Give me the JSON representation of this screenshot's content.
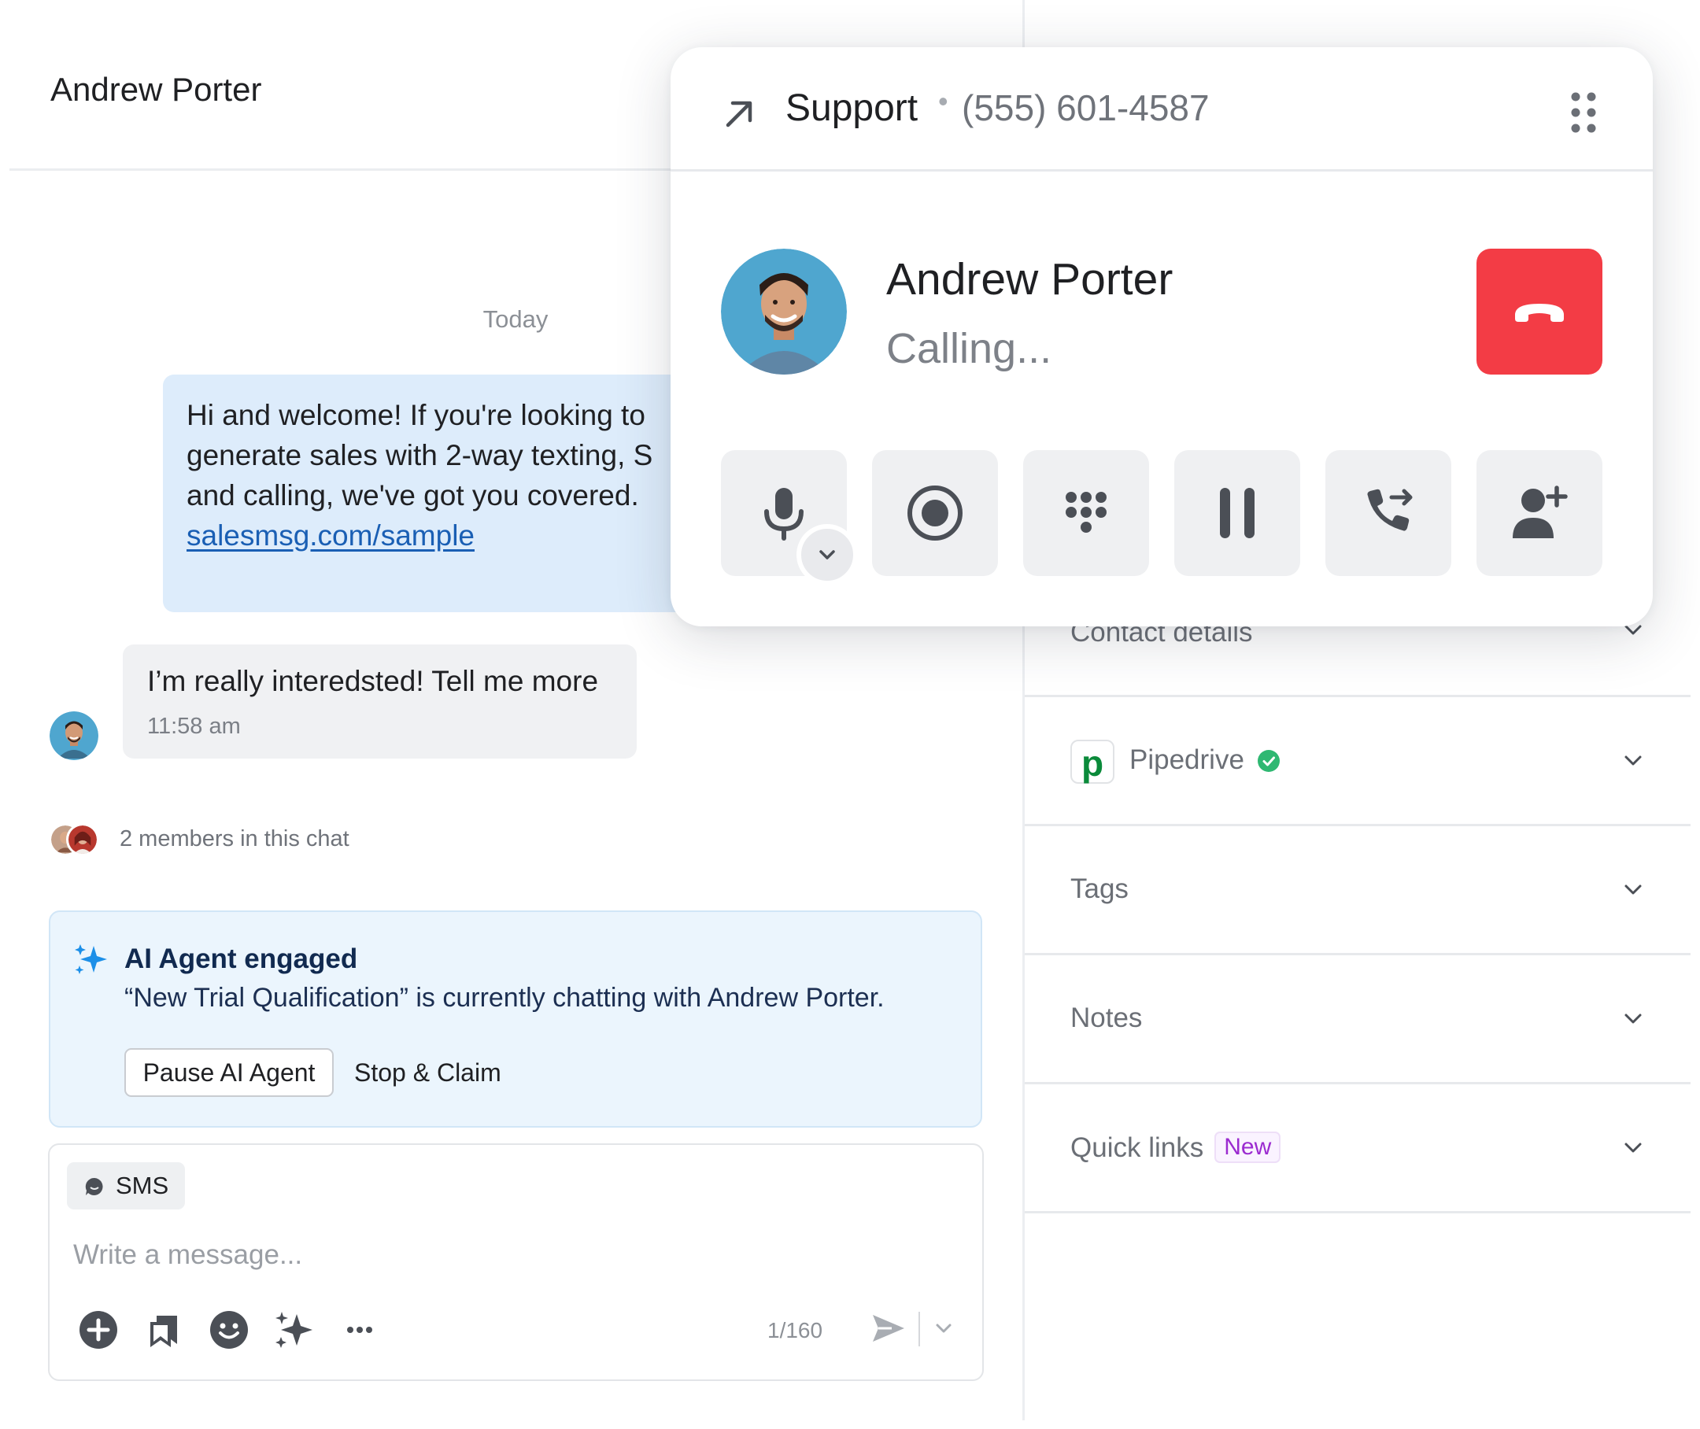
{
  "chat": {
    "title": "Andrew Porter",
    "date_separator": "Today",
    "outgoing_message": {
      "text": "Hi and welcome! If you're looking to generate sales with 2-way texting, S and calling, we've got you covered. ",
      "link_text": "salesmsg.com/sample"
    },
    "incoming_message": {
      "text": "I’m really interedsted! Tell me more",
      "time": "11:58 am"
    },
    "members_label": "2 members in this chat",
    "ai_agent": {
      "title": "AI Agent engaged",
      "body": "“New Trial Qualification” is currently chatting with Andrew Porter.",
      "pause_label": "Pause AI Agent",
      "stop_label": "Stop & Claim"
    },
    "composer": {
      "channel_label": "SMS",
      "placeholder": "Write a message...",
      "counter": "1/160",
      "tools": [
        "add-icon",
        "saved-replies-icon",
        "emoji-icon",
        "ai-sparkle-icon",
        "more-icon"
      ]
    }
  },
  "sidebar": {
    "sections": [
      {
        "label": "Contact details"
      },
      {
        "label": "Pipedrive",
        "verified": true
      },
      {
        "label": "Tags"
      },
      {
        "label": "Notes"
      },
      {
        "label": "Quick links",
        "badge": "New"
      }
    ]
  },
  "call": {
    "line_name": "Support",
    "line_separator": "•",
    "line_number": "(555) 601-4587",
    "contact_name": "Andrew Porter",
    "status": "Calling...",
    "controls": [
      "microphone-icon",
      "record-icon",
      "keypad-icon",
      "pause-icon",
      "transfer-call-icon",
      "add-participant-icon"
    ]
  },
  "colors": {
    "hangup": "#f33c45",
    "outgoing_bubble": "#ddecfb",
    "ai_card": "#ebf5fd",
    "link": "#1a5fb4",
    "pipedrive": "#0a8a3a",
    "verified": "#2fb872",
    "new_badge": "#9b2bd0"
  }
}
